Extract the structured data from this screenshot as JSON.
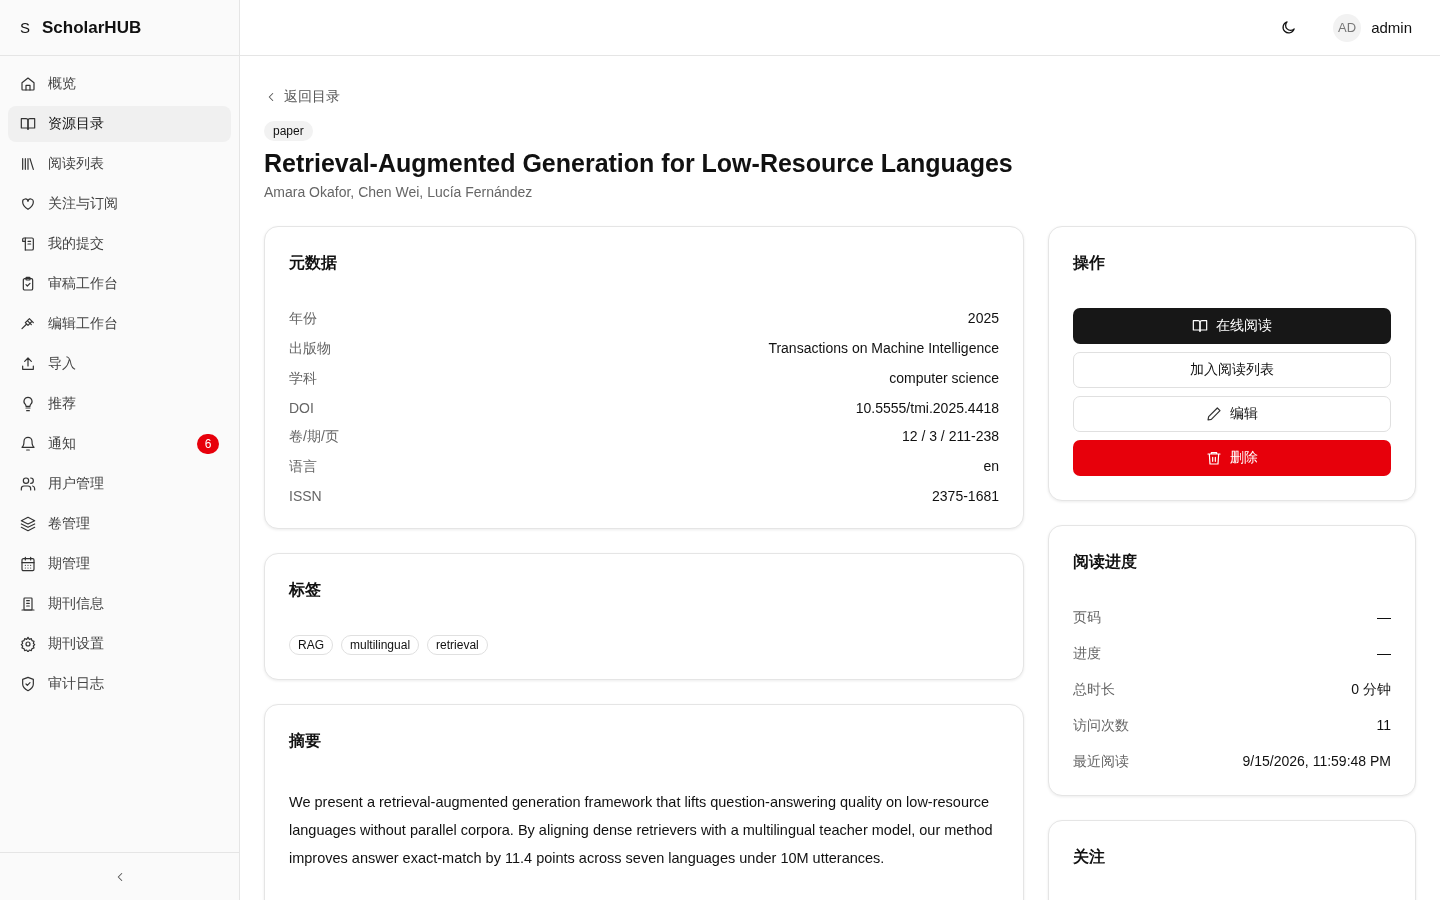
{
  "brand": {
    "mark": "S",
    "name": "ScholarHUB"
  },
  "sidebar": {
    "items": [
      {
        "label": "概览",
        "selected": false
      },
      {
        "label": "资源目录",
        "selected": true
      },
      {
        "label": "阅读列表",
        "selected": false
      },
      {
        "label": "关注与订阅",
        "selected": false
      },
      {
        "label": "我的提交",
        "selected": false
      },
      {
        "label": "审稿工作台",
        "selected": false
      },
      {
        "label": "编辑工作台",
        "selected": false
      },
      {
        "label": "导入",
        "selected": false
      },
      {
        "label": "推荐",
        "selected": false
      },
      {
        "label": "通知",
        "selected": false,
        "badge": "6"
      },
      {
        "label": "用户管理",
        "selected": false
      },
      {
        "label": "卷管理",
        "selected": false
      },
      {
        "label": "期管理",
        "selected": false
      },
      {
        "label": "期刊信息",
        "selected": false
      },
      {
        "label": "期刊设置",
        "selected": false
      },
      {
        "label": "审计日志",
        "selected": false
      }
    ]
  },
  "header": {
    "avatar": "AD",
    "user": "admin"
  },
  "back_link": "返回目录",
  "type_badge": "paper",
  "title": "Retrieval-Augmented Generation for Low-Resource Languages",
  "authors": "Amara Okafor, Chen Wei, Lucía Fernández",
  "metadata": {
    "title": "元数据",
    "rows": [
      {
        "label": "年份",
        "value": "2025"
      },
      {
        "label": "出版物",
        "value": "Transactions on Machine Intelligence"
      },
      {
        "label": "学科",
        "value": "computer science"
      },
      {
        "label": "DOI",
        "value": "10.5555/tmi.2025.4418"
      },
      {
        "label": "卷/期/页",
        "value": "12 / 3 / 211-238"
      },
      {
        "label": "语言",
        "value": "en"
      },
      {
        "label": "ISSN",
        "value": "2375-1681"
      }
    ]
  },
  "tags": {
    "title": "标签",
    "items": [
      "RAG",
      "multilingual",
      "retrieval"
    ]
  },
  "abstract": {
    "title": "摘要",
    "text": "We present a retrieval-augmented generation framework that lifts question-answering quality on low-resource languages without parallel corpora. By aligning dense retrievers with a multilingual teacher model, our method improves answer exact-match by 11.4 points across seven languages under 10M utterances."
  },
  "actions": {
    "title": "操作",
    "buttons": [
      {
        "label": "在线阅读",
        "kind": "primary"
      },
      {
        "label": "加入阅读列表",
        "kind": "outline"
      },
      {
        "label": "编辑",
        "kind": "outline"
      },
      {
        "label": "删除",
        "kind": "danger"
      }
    ]
  },
  "progress": {
    "title": "阅读进度",
    "rows": [
      {
        "label": "页码",
        "value": "—"
      },
      {
        "label": "进度",
        "value": "—"
      },
      {
        "label": "总时长",
        "value": "0 分钟"
      },
      {
        "label": "访问次数",
        "value": "11"
      },
      {
        "label": "最近阅读",
        "value": "9/15/2026, 11:59:48 PM"
      }
    ]
  },
  "follow": {
    "title": "关注"
  }
}
